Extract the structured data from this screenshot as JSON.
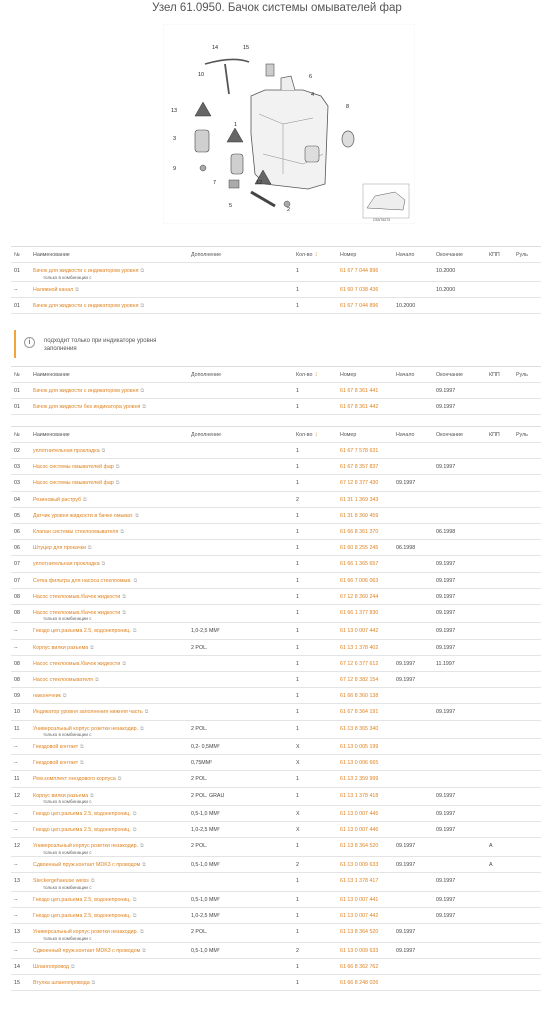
{
  "title": "Узел 61.0950. Бачок системы омывателей фар",
  "diagram": {
    "callouts": [
      "14",
      "15",
      "10",
      "6",
      "4",
      "8",
      "13",
      "3",
      "1",
      "12",
      "9",
      "7",
      "11",
      "5",
      "2"
    ],
    "code": "C53/76273"
  },
  "columns": [
    "№",
    "Наименование",
    "Дополнение",
    "Кол-во",
    "Номер",
    "Начало",
    "Окончание",
    "КПП",
    "Руль"
  ],
  "table1": [
    {
      "no": "01",
      "name": "Бачок для жидкости с индикатором уровня",
      "sub": "только в комбинации с",
      "extra": "",
      "qty": "1",
      "number": "61 67 7 044 896",
      "start": "",
      "end": "10.2000",
      "kpp": "",
      "wheel": ""
    },
    {
      "no": "--",
      "name": "Наливной канал",
      "sub": "",
      "extra": "",
      "qty": "1",
      "number": "61 60 7 038 436",
      "start": "",
      "end": "10.2000",
      "kpp": "",
      "wheel": ""
    },
    {
      "no": "01",
      "name": "Бачок для жидкости с индикатором уровня",
      "sub": "",
      "extra": "",
      "qty": "1",
      "number": "61 67 7 044 896",
      "start": "10.2000",
      "end": "",
      "kpp": "",
      "wheel": ""
    }
  ],
  "notice": "подходит только при индикаторе уровня заполнения",
  "table2": [
    {
      "no": "01",
      "name": "Бачок для жидкости с индикатором уровня",
      "sub": "",
      "extra": "",
      "qty": "1",
      "number": "61 67 8 361 441",
      "start": "",
      "end": "09.1997",
      "kpp": "",
      "wheel": ""
    },
    {
      "no": "01",
      "name": "Бачок для жидкости без индикатора уровня",
      "sub": "",
      "extra": "",
      "qty": "1",
      "number": "61 67 8 361 442",
      "start": "",
      "end": "09.1997",
      "kpp": "",
      "wheel": ""
    }
  ],
  "table3": [
    {
      "no": "02",
      "name": "уплотнительная прокладка",
      "sub": "",
      "extra": "",
      "qty": "1",
      "number": "61 67 7 578 631",
      "start": "",
      "end": "",
      "kpp": "",
      "wheel": ""
    },
    {
      "no": "03",
      "name": "Насос системы омывателей фар",
      "sub": "",
      "extra": "",
      "qty": "1",
      "number": "61 67 8 357 837",
      "start": "",
      "end": "09.1997",
      "kpp": "",
      "wheel": ""
    },
    {
      "no": "03",
      "name": "Насос системы омывателей фар",
      "sub": "",
      "extra": "",
      "qty": "1",
      "number": "67 12 8 377 430",
      "start": "09.1997",
      "end": "",
      "kpp": "",
      "wheel": ""
    },
    {
      "no": "04",
      "name": "Резиновый раструб",
      "sub": "",
      "extra": "",
      "qty": "2",
      "number": "61 31 1 369 343",
      "start": "",
      "end": "",
      "kpp": "",
      "wheel": ""
    },
    {
      "no": "05",
      "name": "Датчик уровня жидкости в бачке омыват.",
      "sub": "",
      "extra": "",
      "qty": "1",
      "number": "61 31 8 360 459",
      "start": "",
      "end": "",
      "kpp": "",
      "wheel": ""
    },
    {
      "no": "06",
      "name": "Клапан системы стеклоомывателя",
      "sub": "",
      "extra": "",
      "qty": "1",
      "number": "61 66 8 361 370",
      "start": "",
      "end": "06.1998",
      "kpp": "",
      "wheel": ""
    },
    {
      "no": "06",
      "name": "Штуцер для прокачки",
      "sub": "",
      "extra": "",
      "qty": "1",
      "number": "61 60 8 255 245",
      "start": "06.1998",
      "end": "",
      "kpp": "",
      "wheel": ""
    },
    {
      "no": "07",
      "name": "уплотнительная прокладка",
      "sub": "",
      "extra": "",
      "qty": "1",
      "number": "61 66 1 365 657",
      "start": "",
      "end": "09.1997",
      "kpp": "",
      "wheel": ""
    },
    {
      "no": "07",
      "name": "Сетка фильтра для насоса стеклоомыв.",
      "sub": "",
      "extra": "",
      "qty": "1",
      "number": "61 66 7 006 063",
      "start": "",
      "end": "09.1997",
      "kpp": "",
      "wheel": ""
    },
    {
      "no": "08",
      "name": "Насос стеклоомыв./бачок жидкости",
      "sub": "",
      "extra": "",
      "qty": "1",
      "number": "67 12 8 360 244",
      "start": "",
      "end": "09.1997",
      "kpp": "",
      "wheel": ""
    },
    {
      "no": "08",
      "name": "Насос стеклоомыв./бачок жидкости",
      "sub": "только в комбинации с",
      "extra": "",
      "qty": "1",
      "number": "61 66 1 377 830",
      "start": "",
      "end": "09.1997",
      "kpp": "",
      "wheel": ""
    },
    {
      "no": "--",
      "name": "Гнездо цеп.разъема 2.5, водонепрониц.",
      "sub": "",
      "extra": "1,0-2,5 MM²",
      "qty": "1",
      "number": "61 13 0 007 442",
      "start": "",
      "end": "09.1997",
      "kpp": "",
      "wheel": ""
    },
    {
      "no": "--",
      "name": "Корпус вилки разъема",
      "sub": "",
      "extra": "2 POL.",
      "qty": "1",
      "number": "61 13 1 378 402",
      "start": "",
      "end": "09.1997",
      "kpp": "",
      "wheel": ""
    },
    {
      "no": "08",
      "name": "Насос стеклоомыв./бачок жидкости",
      "sub": "",
      "extra": "",
      "qty": "1",
      "number": "67 12 6 377 612",
      "start": "09.1997",
      "end": "11.1997",
      "kpp": "",
      "wheel": ""
    },
    {
      "no": "08",
      "name": "Насос стеклоомывателя",
      "sub": "",
      "extra": "",
      "qty": "1",
      "number": "67 12 8 382 154",
      "start": "09.1997",
      "end": "",
      "kpp": "",
      "wheel": ""
    },
    {
      "no": "09",
      "name": "наконечник",
      "sub": "",
      "extra": "",
      "qty": "1",
      "number": "61 66 8 360 138",
      "start": "",
      "end": "",
      "kpp": "",
      "wheel": ""
    },
    {
      "no": "10",
      "name": "Индикатор уровня заполнения нижняя часть",
      "sub": "",
      "extra": "",
      "qty": "1",
      "number": "61 67 8 364 191",
      "start": "",
      "end": "09.1997",
      "kpp": "",
      "wheel": ""
    },
    {
      "no": "11",
      "name": "Универсальный корпус розетки незакодир.",
      "sub": "только в комбинации с",
      "extra": "2 POL.",
      "qty": "1",
      "number": "61 13 8 365 340",
      "start": "",
      "end": "",
      "kpp": "",
      "wheel": ""
    },
    {
      "no": "--",
      "name": "Гнездовой контакт",
      "sub": "",
      "extra": "0,2- 0,5MM²",
      "qty": "X",
      "number": "61 13 0 005 199",
      "start": "",
      "end": "",
      "kpp": "",
      "wheel": ""
    },
    {
      "no": "--",
      "name": "Гнездовой контакт",
      "sub": "",
      "extra": "0,75MM²",
      "qty": "X",
      "number": "61 13 0 006 665",
      "start": "",
      "end": "",
      "kpp": "",
      "wheel": ""
    },
    {
      "no": "11",
      "name": "Рем.комплект гнездового корпуса",
      "sub": "",
      "extra": "2 POL.",
      "qty": "1",
      "number": "61 13 2 359 999",
      "start": "",
      "end": "",
      "kpp": "",
      "wheel": ""
    },
    {
      "no": "12",
      "name": "Корпус вилки разъема",
      "sub": "только в комбинации с",
      "extra": "2 POL. GRAU",
      "qty": "1",
      "number": "61 13 1 378 418",
      "start": "",
      "end": "09.1997",
      "kpp": "",
      "wheel": ""
    },
    {
      "no": "--",
      "name": "Гнездо цеп.разъема 2.5, водонепрониц.",
      "sub": "",
      "extra": "0,5-1,0 MM²",
      "qty": "X",
      "number": "61 13 0 007 445",
      "start": "",
      "end": "09.1997",
      "kpp": "",
      "wheel": ""
    },
    {
      "no": "--",
      "name": "Гнездо цеп.разъема 2.5, водонепрониц.",
      "sub": "",
      "extra": "1,0-2,5 MM²",
      "qty": "X",
      "number": "61 13 0 007 446",
      "start": "",
      "end": "09.1997",
      "kpp": "",
      "wheel": ""
    },
    {
      "no": "12",
      "name": "Универсальный корпус розетки незакодир.",
      "sub": "только в комбинации с",
      "extra": "2 POL.",
      "qty": "1",
      "number": "61 13 8 364 520",
      "start": "09.1997",
      "end": "",
      "kpp": "A",
      "wheel": ""
    },
    {
      "no": "--",
      "name": "Сдвоенный пруж.контакт MDK3 с проводом",
      "sub": "",
      "extra": "0,5-1,0 MM²",
      "qty": "2",
      "number": "61 13 0 009 633",
      "start": "09.1997",
      "end": "",
      "kpp": "A",
      "wheel": ""
    },
    {
      "no": "13",
      "name": "Steckergehaeuse weiss",
      "sub": "только в комбинации с",
      "extra": "",
      "qty": "1",
      "number": "61 13 1 378 417",
      "start": "",
      "end": "09.1997",
      "kpp": "",
      "wheel": ""
    },
    {
      "no": "--",
      "name": "Гнездо цеп.разъема 2.5, водонепрониц.",
      "sub": "",
      "extra": "0,5-1,0 MM²",
      "qty": "1",
      "number": "61 13 0 007 441",
      "start": "",
      "end": "09.1997",
      "kpp": "",
      "wheel": ""
    },
    {
      "no": "--",
      "name": "Гнездо цеп.разъема 2.5, водонепрониц.",
      "sub": "",
      "extra": "1,0-2,5 MM²",
      "qty": "1",
      "number": "61 13 0 007 442",
      "start": "",
      "end": "09.1997",
      "kpp": "",
      "wheel": ""
    },
    {
      "no": "13",
      "name": "Универсальный корпус розетки незакодир.",
      "sub": "только в комбинации с",
      "extra": "2 POL.",
      "qty": "1",
      "number": "61 13 8 364 520",
      "start": "09.1997",
      "end": "",
      "kpp": "",
      "wheel": ""
    },
    {
      "no": "--",
      "name": "Сдвоенный пруж.контакт MDK3 с проводом",
      "sub": "",
      "extra": "0,5-1,0 MM²",
      "qty": "2",
      "number": "61 13 0 009 633",
      "start": "09.1997",
      "end": "",
      "kpp": "",
      "wheel": ""
    },
    {
      "no": "14",
      "name": "Шлангопровод",
      "sub": "",
      "extra": "",
      "qty": "1",
      "number": "61 66 8 362 762",
      "start": "",
      "end": "",
      "kpp": "",
      "wheel": ""
    },
    {
      "no": "15",
      "name": "Втулка шлангопровода",
      "sub": "",
      "extra": "",
      "qty": "1",
      "number": "61 66 8 248 026",
      "start": "",
      "end": "",
      "kpp": "",
      "wheel": ""
    }
  ],
  "colors": {
    "link": "#e0821e",
    "accent": "#f0a43a"
  }
}
